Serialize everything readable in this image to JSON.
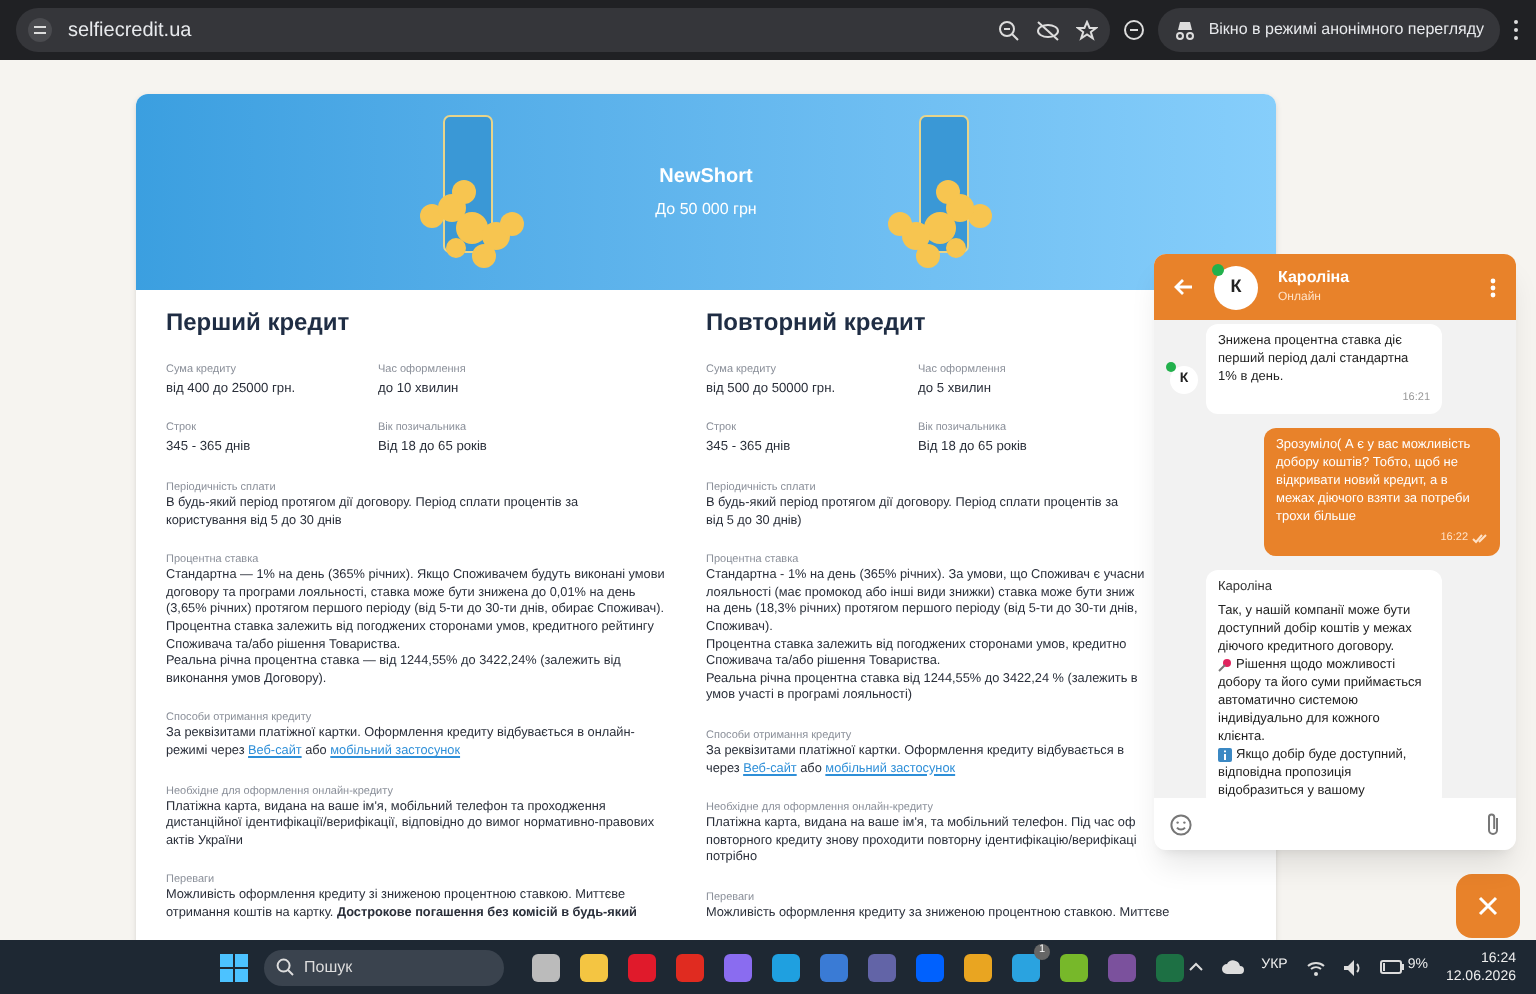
{
  "browser": {
    "url": "selfiecredit.ua",
    "incognito_label": "Вікно в режимі анонімного перегляду"
  },
  "banner": {
    "title": "NewShort",
    "subtitle": "До 50 000 грн"
  },
  "columns": [
    {
      "title": "Перший кредит",
      "facts": [
        {
          "label": "Сума кредиту",
          "value": "від 400 до 25000 грн."
        },
        {
          "label": "Час оформлення",
          "value": "до 10 хвилин"
        },
        {
          "label": "Строк",
          "value": "345 - 365 днів"
        },
        {
          "label": "Вік позичальника",
          "value": "Від 18 до 65 років"
        }
      ],
      "sections": [
        {
          "label": "Періодичність сплати",
          "lines": [
            "В будь-який період протягом дії договору. Період сплати процентів за",
            "користування від 5 до 30 днів"
          ]
        },
        {
          "label": "Процентна ставка",
          "lines": [
            "Стандартна — 1% на день (365% річних). Якщо Споживачем будуть виконані умови",
            "договору та програми лояльності, ставка може бути знижена до 0,01% на день",
            "(3,65% річних) протягом першого періоду (від 5-ти до 30-ти днів, обирає Споживач).",
            "Процентна ставка залежить від погоджених сторонами умов, кредитного рейтингу",
            "Споживача та/або рішення Товариства.",
            "Реальна річна процентна ставка — від 1244,55% до 3422,24% (залежить від",
            "виконання умов Договору)."
          ]
        },
        {
          "label": "Способи отримання кредиту",
          "lines": [
            "За реквізитами платіжної картки. Оформлення кредиту відбувається в онлайн-",
            [
              {
                "kind": "text",
                "text": "режимі через "
              },
              {
                "kind": "link",
                "text": "Веб-сайт"
              },
              {
                "kind": "text",
                "text": " або "
              },
              {
                "kind": "link",
                "text": "мобільний застосунок"
              }
            ]
          ]
        },
        {
          "label": "Необхідне для оформлення онлайн-кредиту",
          "lines": [
            "Платіжна карта, видана на ваше ім'я, мобільний телефон та проходження",
            "дистанційної ідентифікації/верифікації, відповідно до вимог нормативно-правових",
            "актів України"
          ]
        },
        {
          "label": "Переваги",
          "lines": [
            "Можливість оформлення кредиту зі зниженою процентною ставкою. Миттєве",
            [
              {
                "kind": "text",
                "text": "отримання коштів на картку. "
              },
              {
                "kind": "bold",
                "text": "Дострокове погашення без комісій в будь-який"
              }
            ]
          ]
        }
      ]
    },
    {
      "title": "Повторний кредит",
      "facts": [
        {
          "label": "Сума кредиту",
          "value": "від 500 до 50000 грн."
        },
        {
          "label": "Час оформлення",
          "value": "до 5 хвилин"
        },
        {
          "label": "Строк",
          "value": "345 - 365 днів"
        },
        {
          "label": "Вік позичальника",
          "value": "Від 18 до 65 років"
        }
      ],
      "sections": [
        {
          "label": "Періодичність сплати",
          "lines": [
            "В будь-який період протягом дії договору. Період сплати процентів за",
            "від 5 до 30 днів)"
          ]
        },
        {
          "label": "Процентна ставка",
          "lines": [
            "Стандартна - 1% на день (365% річних). За умови, що Споживач є учасни",
            "лояльності (має промокод або інші види знижки) ставка може бути зниж",
            "на день (18,3% річних) протягом першого періоду (від 5-ти до 30-ти днів,",
            "Споживач).",
            "Процентна ставка залежить від погоджених сторонами умов, кредитно",
            "Споживача та/або рішення Товариства.",
            "Реальна річна процентна ставка від 1244,55% до 3422,24 % (залежить в",
            "умов участі в програмі лояльності)"
          ]
        },
        {
          "label": "Способи отримання кредиту",
          "lines": [
            "За реквізитами платіжної картки. Оформлення кредиту відбувається в",
            [
              {
                "kind": "text",
                "text": "через "
              },
              {
                "kind": "link",
                "text": "Веб-сайт"
              },
              {
                "kind": "text",
                "text": " або "
              },
              {
                "kind": "link",
                "text": "мобільний застосунок"
              }
            ]
          ]
        },
        {
          "label": "Необхідне для оформлення онлайн-кредиту",
          "lines": [
            "Платіжна карта, видана на ваше ім'я, та мобільний телефон. Під час оф",
            "повторного кредиту знову проходити повторну ідентифікацію/верифікаці",
            "потрібно"
          ]
        },
        {
          "label": "Переваги",
          "lines": [
            "Можливість оформлення кредиту за зниженою процентною ставкою. Миттєве"
          ]
        }
      ]
    }
  ],
  "chat": {
    "agent": {
      "name": "Кароліна",
      "status": "Онлайн",
      "initial": "К",
      "online": true
    },
    "messages": [
      {
        "kind": "incoming",
        "avatar_initial": "К",
        "lines": [
          {
            "kind": "text",
            "text": "Знижена процентна ставка діє перший період далі стандартна 1% в день."
          }
        ],
        "time": "16:21"
      },
      {
        "kind": "outgoing",
        "lines": [
          {
            "kind": "text",
            "text": "Зрозуміло( А є у вас можливість добору коштів? Тобто, щоб не відкривати новий кредит, а в межах діючого взяти за потреби трохи більше"
          }
        ],
        "time": "16:22",
        "read": true
      },
      {
        "kind": "incoming",
        "sender": "Кароліна",
        "lines": [
          {
            "kind": "text",
            "text": "Так, у нашій компанії може бути доступний добір коштів у межах діючого кредитного договору."
          },
          {
            "kind": "pin",
            "text": "Рішення щодо можливості добору та його суми приймається автоматично системою індивідуально для кожного клієнта."
          },
          {
            "kind": "info",
            "text": "Якщо добір буде доступний, відповідна пропозиція відобразиться у вашому"
          }
        ]
      }
    ]
  },
  "taskbar": {
    "search_placeholder": "Пошук",
    "telegram_badge": "1",
    "language": "УКР",
    "battery": "9%",
    "time": "16:24",
    "date": "12.06.2026"
  }
}
